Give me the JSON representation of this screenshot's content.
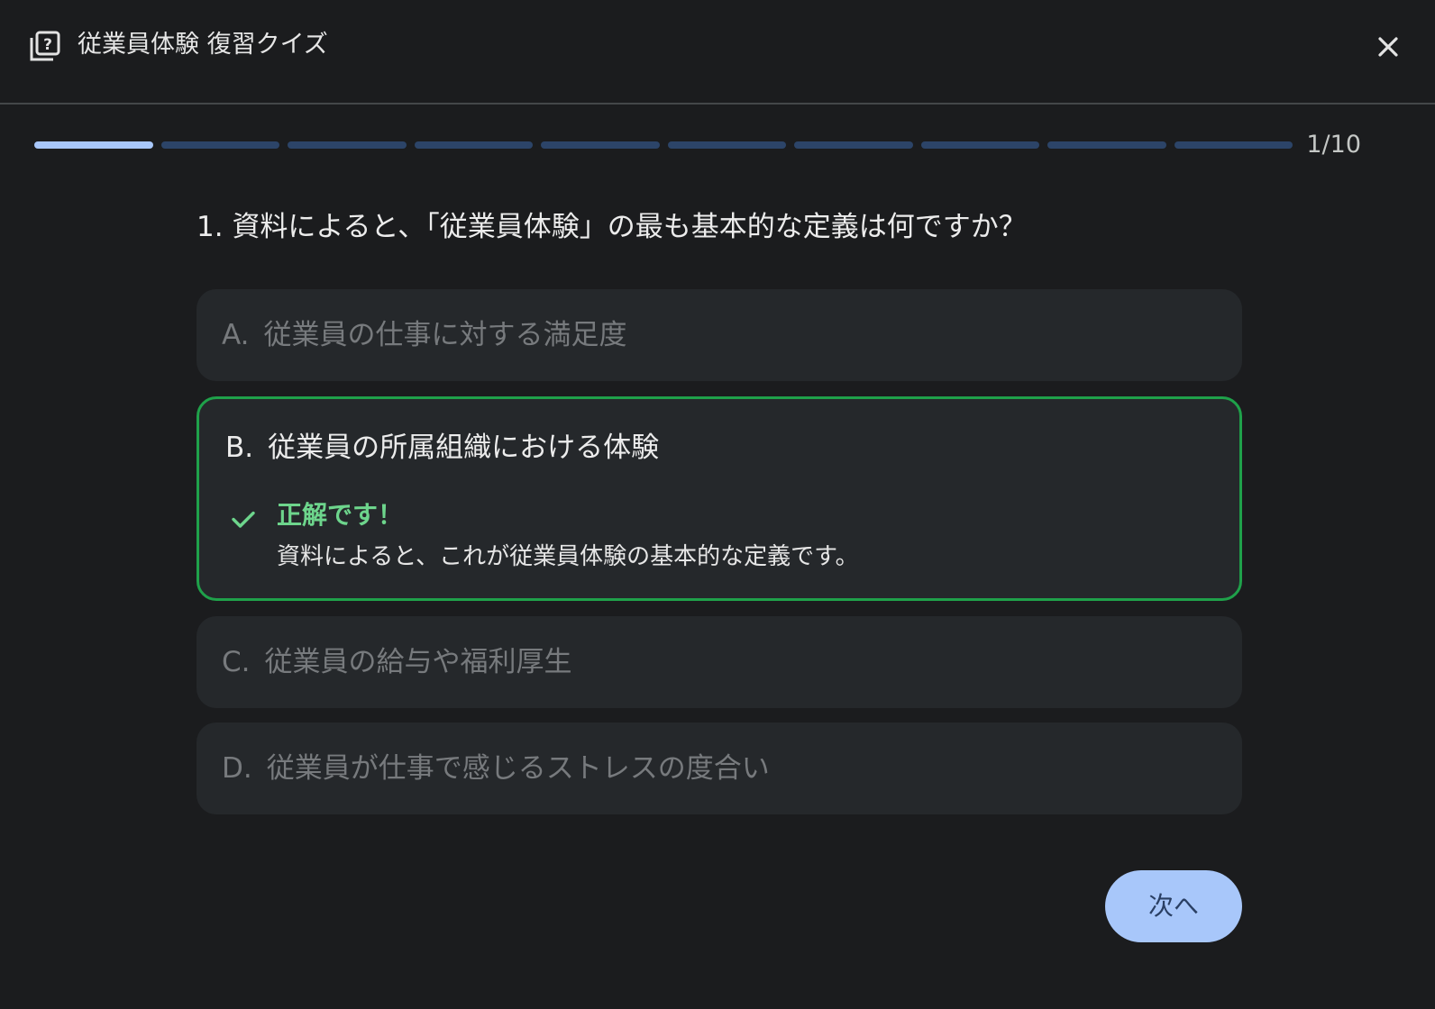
{
  "header": {
    "title": "従業員体験 復習クイズ",
    "icon": "quiz-icon",
    "close_icon": "close-icon"
  },
  "progress": {
    "current": 1,
    "total": 10,
    "label": "1/10"
  },
  "question": {
    "number": "1.",
    "text": "資料によると、「従業員体験」の最も基本的な定義は何ですか？"
  },
  "options": [
    {
      "letter": "A.",
      "text": "従業員の仕事に対する満足度",
      "state": "unselected"
    },
    {
      "letter": "B.",
      "text": "従業員の所属組織における体験",
      "state": "correct"
    },
    {
      "letter": "C.",
      "text": "従業員の給与や福利厚生",
      "state": "unselected"
    },
    {
      "letter": "D.",
      "text": "従業員が仕事で感じるストレスの度合い",
      "state": "unselected"
    }
  ],
  "feedback": {
    "title": "正解です！",
    "body": "資料によると、これが従業員体験の基本的な定義です。",
    "icon": "check-icon"
  },
  "next_button": {
    "label": "次へ"
  },
  "colors": {
    "background": "#1b1c1e",
    "option_bg": "#25282b",
    "correct_border": "#1fa14a",
    "correct_text": "#6dd58c",
    "progress_done": "#a8c7fa",
    "progress_todo": "#2c4468",
    "button_bg": "#a8c7fa"
  }
}
